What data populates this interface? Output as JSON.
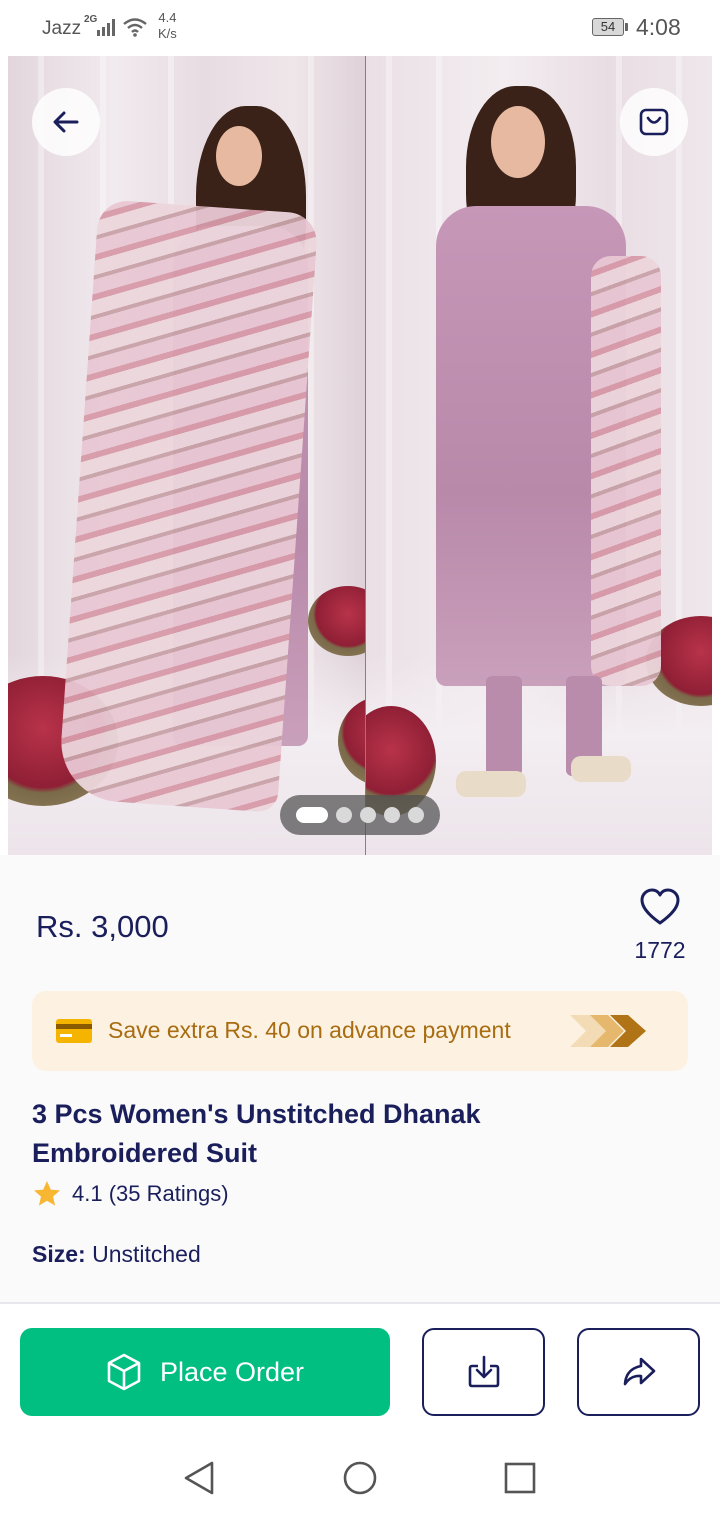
{
  "status_bar": {
    "carrier": "Jazz",
    "network": "2G",
    "speed_value": "4.4",
    "speed_unit": "K/s",
    "battery": "54",
    "time": "4:08"
  },
  "gallery": {
    "image_count": 5,
    "active_index": 0
  },
  "product": {
    "price": "Rs. 3,000",
    "favorites": "1772",
    "promo_text": "Save extra Rs. 40 on advance payment",
    "title": "3 Pcs Women's Unstitched Dhanak Embroidered Suit",
    "rating_text": "4.1 (35 Ratings)",
    "size_label": "Size:",
    "size_value": "Unstitched"
  },
  "actions": {
    "place_order_label": "Place Order"
  },
  "colors": {
    "primary_text": "#1a1f5c",
    "accent_green": "#00bf80",
    "promo_bg": "#fdf2e1",
    "promo_text": "#a86c12",
    "star": "#f7b733"
  },
  "icons": [
    "back-arrow-icon",
    "shopping-bag-icon",
    "heart-icon",
    "credit-card-icon",
    "chevrons-icon",
    "star-icon",
    "box-icon",
    "download-icon",
    "share-icon"
  ]
}
